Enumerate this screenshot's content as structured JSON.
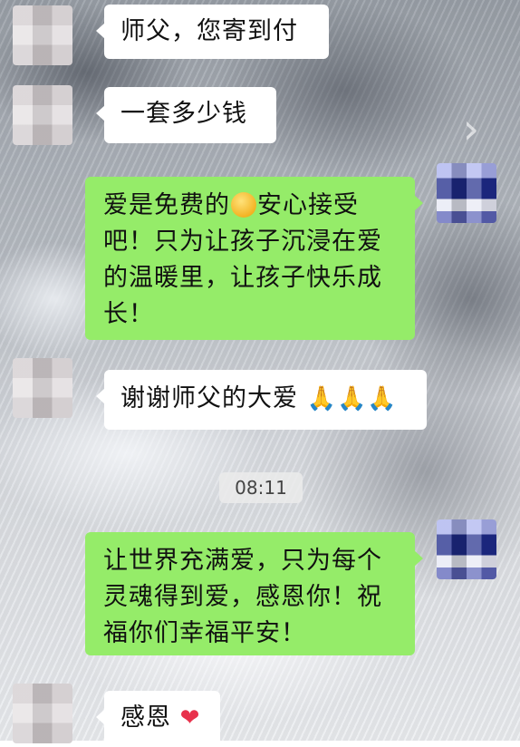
{
  "chat": {
    "messages": [
      {
        "side": "left",
        "text": "师父，您寄到付"
      },
      {
        "side": "left",
        "text": "一套多少钱"
      },
      {
        "side": "right",
        "text_before": "爱是免费的",
        "text_after": "安心接受吧！只为让孩子沉浸在爱的温暖里，让孩子快乐成长！",
        "emoji": "smiling-face"
      },
      {
        "side": "left",
        "text": "谢谢师父的大爱",
        "emoji_text": "🙏🙏🙏"
      },
      {
        "side": "right",
        "text": "让世界充满爱，只为每个灵魂得到爱，感恩你！祝福你们幸福平安！"
      },
      {
        "side": "left",
        "text": "感恩",
        "emoji_text": "❤"
      }
    ],
    "timestamp": "08:11"
  },
  "colors": {
    "incoming_bubble": "#ffffff",
    "outgoing_bubble": "#95ec69"
  },
  "icons": {
    "chevron": "chevron-right-icon",
    "smile": "smiling-face-icon",
    "pray": "folded-hands-icon",
    "heart": "red-heart-icon"
  }
}
